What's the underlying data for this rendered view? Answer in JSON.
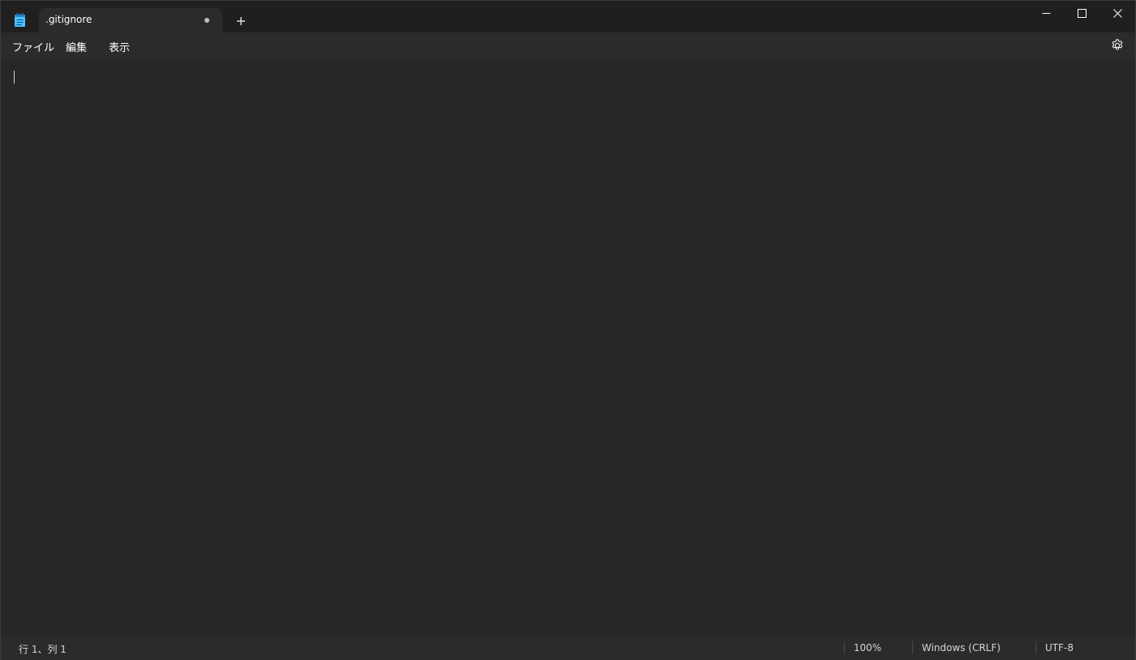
{
  "tab": {
    "title": ".gitignore"
  },
  "menu": {
    "file": "ファイル",
    "edit": "編集",
    "view": "表示"
  },
  "status": {
    "position": "行 1、列 1",
    "zoom": "100%",
    "line_ending": "Windows (CRLF)",
    "encoding": "UTF-8"
  },
  "editor": {
    "content": ""
  },
  "icons": {
    "app": "notepad-icon",
    "unsaved": "unsaved-dot-icon",
    "new_tab": "plus-icon",
    "minimize": "minimize-icon",
    "maximize": "maximize-icon",
    "close": "close-icon",
    "settings": "gear-icon"
  },
  "colors": {
    "titlebar": "#1f1f1f",
    "tab": "#2b2b2b",
    "editor": "#272727",
    "statusbar": "#2b2b2b",
    "app_icon_accent": "#4cc2ff"
  }
}
